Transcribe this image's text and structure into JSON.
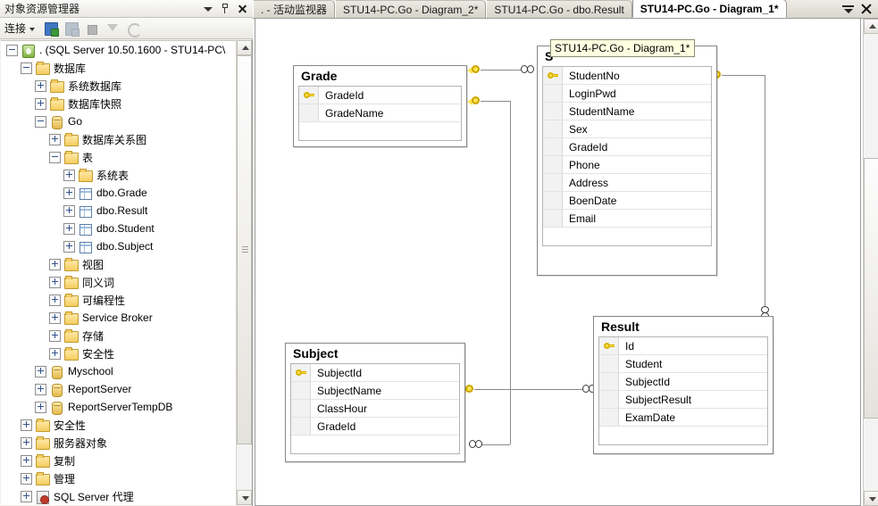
{
  "explorer": {
    "title": "对象资源管理器",
    "title_buttons": [
      {
        "name": "dropdown",
        "glyph": "▼"
      },
      {
        "name": "auto-hide-pin",
        "glyph": "pin"
      },
      {
        "name": "close",
        "glyph": "✕"
      }
    ],
    "toolbar": {
      "connect_label": "连接",
      "icons": [
        "connect-server-icon",
        "disconnect-server-icon",
        "stop-icon",
        "filter-icon",
        "refresh-icon"
      ]
    },
    "tree": [
      {
        "label": ". (SQL Server 10.50.1600 - STU14-PC\\",
        "indent": 0,
        "expander": "minus",
        "icon": "server-icon"
      },
      {
        "label": "数据库",
        "indent": 1,
        "expander": "minus",
        "icon": "folder-icon"
      },
      {
        "label": "系统数据库",
        "indent": 2,
        "expander": "plus",
        "icon": "folder-icon"
      },
      {
        "label": "数据库快照",
        "indent": 2,
        "expander": "plus",
        "icon": "folder-icon"
      },
      {
        "label": "Go",
        "indent": 2,
        "expander": "minus",
        "icon": "database-icon"
      },
      {
        "label": "数据库关系图",
        "indent": 3,
        "expander": "plus",
        "icon": "folder-icon"
      },
      {
        "label": "表",
        "indent": 3,
        "expander": "minus",
        "icon": "folder-icon"
      },
      {
        "label": "系统表",
        "indent": 4,
        "expander": "plus",
        "icon": "folder-icon"
      },
      {
        "label": "dbo.Grade",
        "indent": 4,
        "expander": "plus",
        "icon": "table-icon"
      },
      {
        "label": "dbo.Result",
        "indent": 4,
        "expander": "plus",
        "icon": "table-icon"
      },
      {
        "label": "dbo.Student",
        "indent": 4,
        "expander": "plus",
        "icon": "table-icon"
      },
      {
        "label": "dbo.Subject",
        "indent": 4,
        "expander": "plus",
        "icon": "table-icon"
      },
      {
        "label": "视图",
        "indent": 3,
        "expander": "plus",
        "icon": "folder-icon"
      },
      {
        "label": "同义词",
        "indent": 3,
        "expander": "plus",
        "icon": "folder-icon"
      },
      {
        "label": "可编程性",
        "indent": 3,
        "expander": "plus",
        "icon": "folder-icon"
      },
      {
        "label": "Service Broker",
        "indent": 3,
        "expander": "plus",
        "icon": "folder-icon"
      },
      {
        "label": "存储",
        "indent": 3,
        "expander": "plus",
        "icon": "folder-icon"
      },
      {
        "label": "安全性",
        "indent": 3,
        "expander": "plus",
        "icon": "folder-icon"
      },
      {
        "label": "Myschool",
        "indent": 2,
        "expander": "plus",
        "icon": "database-icon"
      },
      {
        "label": "ReportServer",
        "indent": 2,
        "expander": "plus",
        "icon": "database-icon"
      },
      {
        "label": "ReportServerTempDB",
        "indent": 2,
        "expander": "plus",
        "icon": "database-icon"
      },
      {
        "label": "安全性",
        "indent": 1,
        "expander": "plus",
        "icon": "folder-icon"
      },
      {
        "label": "服务器对象",
        "indent": 1,
        "expander": "plus",
        "icon": "folder-icon"
      },
      {
        "label": "复制",
        "indent": 1,
        "expander": "plus",
        "icon": "folder-icon"
      },
      {
        "label": "管理",
        "indent": 1,
        "expander": "plus",
        "icon": "folder-icon"
      },
      {
        "label": "SQL Server 代理",
        "indent": 1,
        "expander": "plus",
        "icon": "agent-icon"
      }
    ]
  },
  "tabs": {
    "items": [
      {
        "label": ". - 活动监视器",
        "active": false
      },
      {
        "label": "STU14-PC.Go - Diagram_2*",
        "active": false
      },
      {
        "label": "STU14-PC.Go - dbo.Result",
        "active": false
      },
      {
        "label": "STU14-PC.Go - Diagram_1*",
        "active": true
      }
    ],
    "controls": [
      {
        "name": "tab-list-menu",
        "glyph": "menu"
      },
      {
        "name": "close-document",
        "glyph": "✕"
      }
    ]
  },
  "tooltip": {
    "text": "STU14-PC.Go - Diagram_1*",
    "bg": "#ffffe1"
  },
  "diagram": {
    "tables": [
      {
        "name": "Grade",
        "title_visible": "Grade",
        "columns": [
          {
            "name": "GradeId",
            "key": true
          },
          {
            "name": "GradeName",
            "key": false
          }
        ]
      },
      {
        "name": "Student",
        "title_visible": "S",
        "columns": [
          {
            "name": "StudentNo",
            "key": true
          },
          {
            "name": "LoginPwd",
            "key": false
          },
          {
            "name": "StudentName",
            "key": false
          },
          {
            "name": "Sex",
            "key": false
          },
          {
            "name": "GradeId",
            "key": false
          },
          {
            "name": "Phone",
            "key": false
          },
          {
            "name": "Address",
            "key": false
          },
          {
            "name": "BoenDate",
            "key": false
          },
          {
            "name": "Email",
            "key": false
          }
        ]
      },
      {
        "name": "Subject",
        "title_visible": "Subject",
        "columns": [
          {
            "name": "SubjectId",
            "key": true
          },
          {
            "name": "SubjectName",
            "key": false
          },
          {
            "name": "ClassHour",
            "key": false
          },
          {
            "name": "GradeId",
            "key": false
          }
        ]
      },
      {
        "name": "Result",
        "title_visible": "Result",
        "columns": [
          {
            "name": "Id",
            "key": true
          },
          {
            "name": "Student",
            "key": false
          },
          {
            "name": "SubjectId",
            "key": false
          },
          {
            "name": "SubjectResult",
            "key": false
          },
          {
            "name": "ExamDate",
            "key": false
          }
        ]
      }
    ],
    "relationships": [
      {
        "from": "Grade",
        "to": "Student",
        "from_end": "one-key",
        "to_end": "many-infinity"
      },
      {
        "from": "Grade",
        "to": "Subject",
        "from_end": "one-key",
        "to_end": "many-infinity"
      },
      {
        "from": "Student",
        "to": "Result",
        "from_end": "one-key",
        "to_end": "many-infinity"
      },
      {
        "from": "Subject",
        "to": "Result",
        "from_end": "one-key",
        "to_end": "many-infinity"
      }
    ]
  },
  "colors": {
    "chrome": "#f1f0ee",
    "tooltip_bg": "#ffffe1",
    "key_yellow": "#ffe34f",
    "line": "#8a8a8a",
    "canvas": "#ffffff"
  }
}
